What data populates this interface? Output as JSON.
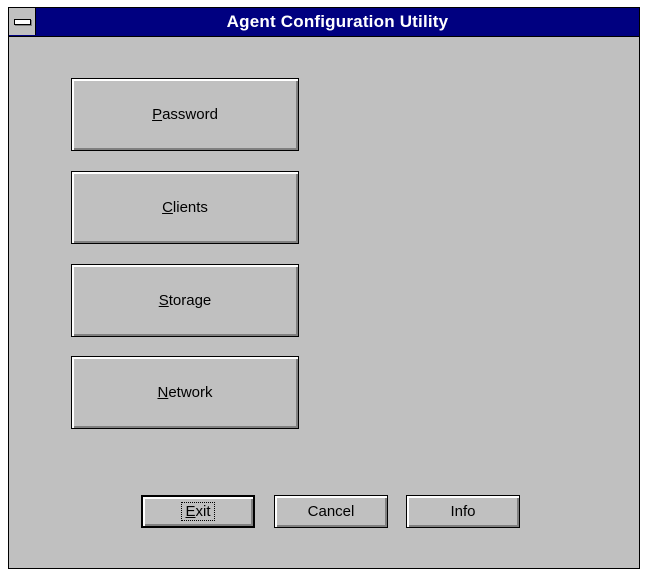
{
  "window": {
    "title": "Agent Configuration Utility",
    "titlebar_color": "#000080",
    "face_color": "#c0c0c0"
  },
  "system_menu": {
    "icon": "system-menu-icon"
  },
  "main_buttons": [
    {
      "mnemonic": "P",
      "rest": "assword"
    },
    {
      "mnemonic": "C",
      "rest": "lients"
    },
    {
      "mnemonic": "S",
      "rest": "torage"
    },
    {
      "mnemonic": "N",
      "rest": "etwork"
    }
  ],
  "dialog_buttons": {
    "exit": {
      "mnemonic": "E",
      "rest": "xit",
      "default": true
    },
    "cancel": {
      "label": "Cancel"
    },
    "info": {
      "label": "Info"
    }
  }
}
